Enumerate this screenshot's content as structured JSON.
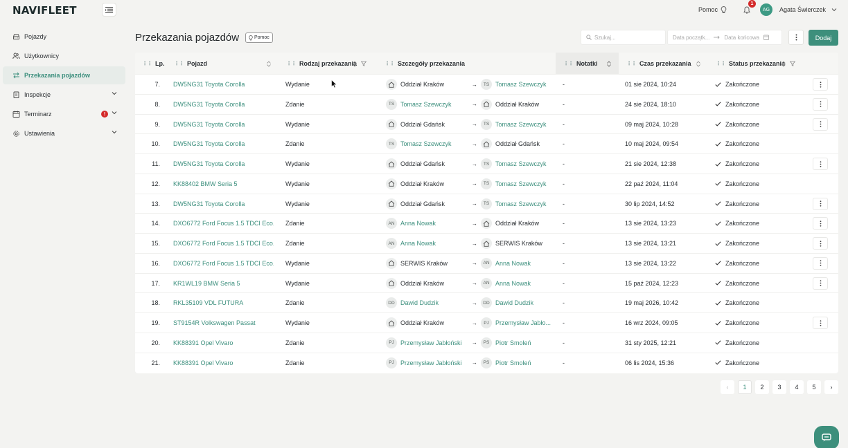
{
  "app": {
    "logo": "NAVIFLEET",
    "help_label": "Pomoc",
    "notification_count": "1",
    "user_initials": "AG",
    "user_name": "Agata Świerczek"
  },
  "sidebar": {
    "items": [
      {
        "label": "Pojazdy",
        "icon": "car-icon"
      },
      {
        "label": "Użytkownicy",
        "icon": "users-icon"
      },
      {
        "label": "Przekazania pojazdów",
        "icon": "swap-icon",
        "active": true
      },
      {
        "label": "Inspekcje",
        "icon": "clipboard-icon"
      },
      {
        "label": "Terminarz",
        "icon": "calendar-icon",
        "badge": "!"
      },
      {
        "label": "Ustawienia",
        "icon": "gear-icon"
      }
    ]
  },
  "page": {
    "title": "Przekazania pojazdów",
    "help_pill": "Pomoc",
    "search_placeholder": "Szukaj...",
    "date_start_placeholder": "Data początk...",
    "date_end_placeholder": "Data końcowa",
    "add_label": "Dodaj"
  },
  "table": {
    "headers": {
      "lp": "Lp.",
      "vehicle": "Pojazd",
      "type": "Rodzaj przekazania",
      "details": "Szczegóły przekazania",
      "notes": "Notatki",
      "time": "Czas przekazania",
      "status": "Status przekazania"
    },
    "rows": [
      {
        "lp": "7.",
        "vehicle": "DW5NG31 Toyota Corolla",
        "type": "Wydanie",
        "src": {
          "kind": "branch",
          "name": "Oddział Kraków"
        },
        "dst": {
          "kind": "person",
          "ini": "TS",
          "name": "Tomasz Szewczyk"
        },
        "notes": "-",
        "time": "01 sie 2024, 10:24",
        "status": "Zakończone",
        "menu": true
      },
      {
        "lp": "8.",
        "vehicle": "DW5NG31 Toyota Corolla",
        "type": "Zdanie",
        "src": {
          "kind": "person",
          "ini": "TS",
          "name": "Tomasz Szewczyk"
        },
        "dst": {
          "kind": "branch",
          "name": "Oddział Kraków"
        },
        "notes": "-",
        "time": "24 sie 2024, 18:10",
        "status": "Zakończone",
        "menu": true
      },
      {
        "lp": "9.",
        "vehicle": "DW5NG31 Toyota Corolla",
        "type": "Wydanie",
        "src": {
          "kind": "branch",
          "name": "Oddział Gdańsk"
        },
        "dst": {
          "kind": "person",
          "ini": "TS",
          "name": "Tomasz Szewczyk"
        },
        "notes": "-",
        "time": "09 maj 2024, 10:28",
        "status": "Zakończone",
        "menu": true
      },
      {
        "lp": "10.",
        "vehicle": "DW5NG31 Toyota Corolla",
        "type": "Zdanie",
        "src": {
          "kind": "person",
          "ini": "TS",
          "name": "Tomasz Szewczyk"
        },
        "dst": {
          "kind": "branch",
          "name": "Oddział Gdańsk"
        },
        "notes": "-",
        "time": "10 maj 2024, 09:54",
        "status": "Zakończone",
        "menu": false
      },
      {
        "lp": "11.",
        "vehicle": "DW5NG31 Toyota Corolla",
        "type": "Wydanie",
        "src": {
          "kind": "branch",
          "name": "Oddział Gdańsk"
        },
        "dst": {
          "kind": "person",
          "ini": "TS",
          "name": "Tomasz Szewczyk"
        },
        "notes": "-",
        "time": "21 sie 2024, 12:38",
        "status": "Zakończone",
        "menu": true
      },
      {
        "lp": "12.",
        "vehicle": "KK88402 BMW Seria 5",
        "type": "Wydanie",
        "src": {
          "kind": "branch",
          "name": "Oddział Kraków"
        },
        "dst": {
          "kind": "person",
          "ini": "TS",
          "name": "Tomasz Szewczyk"
        },
        "notes": "-",
        "time": "22 paź 2024, 11:04",
        "status": "Zakończone",
        "menu": false
      },
      {
        "lp": "13.",
        "vehicle": "DW5NG31 Toyota Corolla",
        "type": "Wydanie",
        "src": {
          "kind": "branch",
          "name": "Oddział Gdańsk"
        },
        "dst": {
          "kind": "person",
          "ini": "TS",
          "name": "Tomasz Szewczyk"
        },
        "notes": "-",
        "time": "30 lip 2024, 14:52",
        "status": "Zakończone",
        "menu": true
      },
      {
        "lp": "14.",
        "vehicle": "DXO6772 Ford Focus 1.5 TDCI Eco...",
        "type": "Zdanie",
        "src": {
          "kind": "person",
          "ini": "AN",
          "name": "Anna Nowak"
        },
        "dst": {
          "kind": "branch",
          "name": "Oddział Kraków"
        },
        "notes": "-",
        "time": "13 sie 2024, 13:23",
        "status": "Zakończone",
        "menu": true
      },
      {
        "lp": "15.",
        "vehicle": "DXO6772 Ford Focus 1.5 TDCI Eco...",
        "type": "Zdanie",
        "src": {
          "kind": "person",
          "ini": "AN",
          "name": "Anna Nowak"
        },
        "dst": {
          "kind": "branch",
          "name": "SERWIS Kraków"
        },
        "notes": "-",
        "time": "13 sie 2024, 13:21",
        "status": "Zakończone",
        "menu": true
      },
      {
        "lp": "16.",
        "vehicle": "DXO6772 Ford Focus 1.5 TDCI Eco...",
        "type": "Wydanie",
        "src": {
          "kind": "branch",
          "name": "SERWIS Kraków"
        },
        "dst": {
          "kind": "person",
          "ini": "AN",
          "name": "Anna Nowak"
        },
        "notes": "-",
        "time": "13 sie 2024, 13:22",
        "status": "Zakończone",
        "menu": true
      },
      {
        "lp": "17.",
        "vehicle": "KR1WL19 BMW Seria 5",
        "type": "Wydanie",
        "src": {
          "kind": "branch",
          "name": "Oddział Kraków"
        },
        "dst": {
          "kind": "person",
          "ini": "AN",
          "name": "Anna Nowak"
        },
        "notes": "-",
        "time": "15 paź 2024, 12:23",
        "status": "Zakończone",
        "menu": true
      },
      {
        "lp": "18.",
        "vehicle": "RKL35109 VDL FUTURA",
        "type": "Zdanie",
        "src": {
          "kind": "person",
          "ini": "DD",
          "name": "Dawid Dudzik"
        },
        "dst": {
          "kind": "person",
          "ini": "DD",
          "name": "Dawid Dudzik"
        },
        "notes": "-",
        "time": "19 maj 2026, 10:42",
        "status": "Zakończone",
        "menu": false
      },
      {
        "lp": "19.",
        "vehicle": "ST9154R Volkswagen Passat",
        "type": "Wydanie",
        "src": {
          "kind": "branch",
          "name": "Oddział Kraków"
        },
        "dst": {
          "kind": "person",
          "ini": "PJ",
          "name": "Przemysław Jabło..."
        },
        "notes": "-",
        "time": "16 wrz 2024, 09:05",
        "status": "Zakończone",
        "menu": true
      },
      {
        "lp": "20.",
        "vehicle": "KK88391 Opel Vivaro",
        "type": "Zdanie",
        "src": {
          "kind": "person",
          "ini": "PJ",
          "name": "Przemysław Jabłoński"
        },
        "dst": {
          "kind": "person",
          "ini": "PS",
          "name": "Piotr Smoleń"
        },
        "notes": "-",
        "time": "31 sty 2025, 12:21",
        "status": "Zakończone",
        "menu": false
      },
      {
        "lp": "21.",
        "vehicle": "KK88391 Opel Vivaro",
        "type": "Zdanie",
        "src": {
          "kind": "person",
          "ini": "PJ",
          "name": "Przemysław Jabłoński"
        },
        "dst": {
          "kind": "person",
          "ini": "PS",
          "name": "Piotr Smoleń"
        },
        "notes": "-",
        "time": "06 lis 2024, 15:36",
        "status": "Zakończone",
        "menu": false
      }
    ]
  },
  "pagination": {
    "prev": "‹",
    "next": "›",
    "pages": [
      "1",
      "2",
      "3",
      "4",
      "5"
    ],
    "current": "1"
  },
  "colors": {
    "accent": "#3d8f7c",
    "link": "#3c8f7d",
    "badge": "#d42a2a"
  }
}
